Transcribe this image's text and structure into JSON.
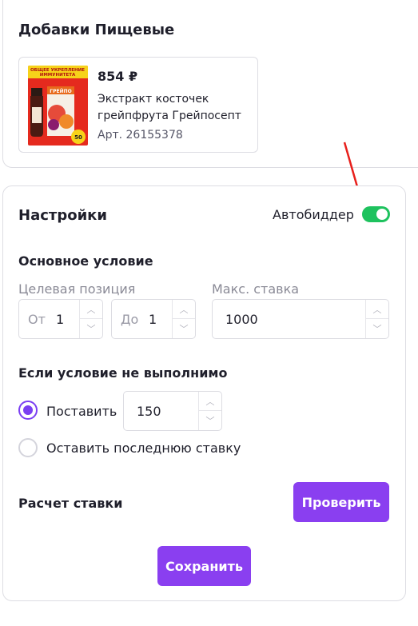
{
  "category": {
    "title": "Добавки Пищевые"
  },
  "product": {
    "price": "854 ₽",
    "name": "Экстракт косточек грейпфрута Грейпосепт",
    "article": "Арт. 26155378",
    "image_banner": "ОБЩЕЕ УКРЕПЛЕНИЕ ИММУНИТЕТА",
    "image_badge": "50"
  },
  "settings": {
    "title": "Настройки",
    "autobidder_label": "Автобиддер",
    "autobidder_on": true
  },
  "main_condition": {
    "title": "Основное условие",
    "target_position_label": "Целевая позиция",
    "max_bid_label": "Макс. ставка",
    "from_prefix": "От",
    "from_value": "1",
    "to_prefix": "До",
    "to_value": "1",
    "max_bid_value": "1000"
  },
  "fallback": {
    "title": "Если условие не выполнимо",
    "option_set_label": "Поставить",
    "option_set_value": "150",
    "option_keep_label": "Оставить последнюю ставку",
    "selected": "set"
  },
  "bid_calc": {
    "label": "Расчет ставки",
    "check_button": "Проверить"
  },
  "save_button": "Сохранить",
  "colors": {
    "accent": "#8a3ff0",
    "toggle_on": "#1ec25e",
    "annotation_arrow": "#e8201c"
  }
}
